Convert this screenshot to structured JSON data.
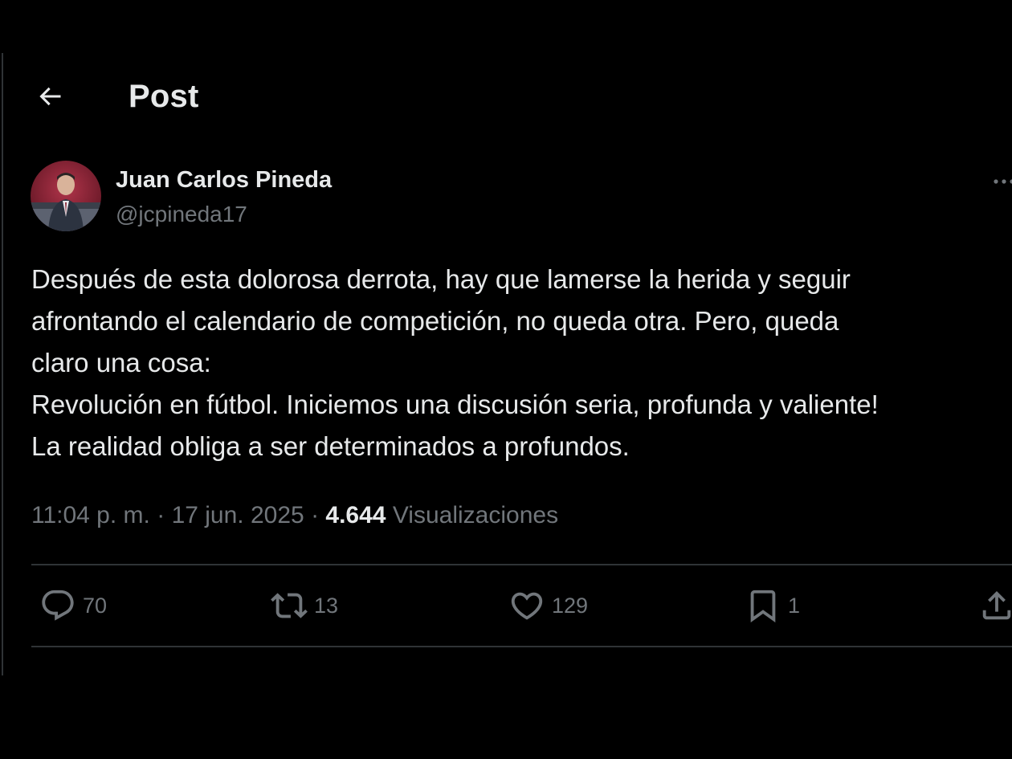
{
  "header": {
    "title": "Post",
    "back_icon": "arrow-left-icon"
  },
  "author": {
    "display_name": "Juan Carlos Pineda",
    "handle": "@jcpineda17"
  },
  "post": {
    "lines": [
      "Después de esta dolorosa derrota, hay que lamerse la herida y seguir",
      "afrontando el calendario de competición, no queda otra. Pero, queda",
      "claro una cosa:",
      "Revolución en fútbol. Iniciemos una discusión seria, profunda y valiente!",
      "La realidad obliga a ser determinados a profundos."
    ],
    "time": "11:04 p. m.",
    "separator": "·",
    "date": "17 jun. 2025",
    "views_count": "4.644",
    "views_label": "Visualizaciones"
  },
  "actions": {
    "replies": "70",
    "reposts": "13",
    "likes": "129",
    "bookmarks": "1"
  },
  "colors": {
    "background": "#000000",
    "text_primary": "#e7e9ea",
    "text_secondary": "#71767b",
    "divider": "#2f3336"
  }
}
